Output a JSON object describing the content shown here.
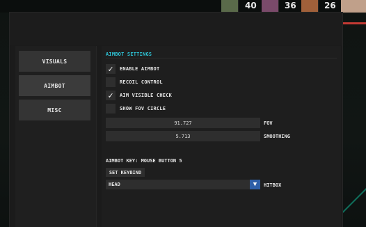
{
  "hud": {
    "counts": [
      "40",
      "36",
      "26"
    ]
  },
  "sidebar": {
    "tabs": [
      {
        "label": "VISUALS"
      },
      {
        "label": "AIMBOT"
      },
      {
        "label": "MISC"
      }
    ]
  },
  "aimbot": {
    "section_title": "AIMBOT SETTINGS",
    "checkboxes": [
      {
        "label": "ENABLE AIMBOT",
        "checked_mark": "✓"
      },
      {
        "label": "RECOIL CONTROL",
        "checked_mark": ""
      },
      {
        "label": "AIM VISIBLE CHECK",
        "checked_mark": "✓"
      },
      {
        "label": "SHOW FOV CIRCLE",
        "checked_mark": ""
      }
    ],
    "sliders": [
      {
        "value": "91.727",
        "label": "FOV"
      },
      {
        "value": "5.713",
        "label": "SMOOTHING"
      }
    ],
    "key_text": "AIMBOT KEY: MOUSE BUTTON 5",
    "set_keybind_label": "SET KEYBIND",
    "hitbox": {
      "value": "HEAD",
      "label": "HITBOX",
      "arrow": "▼"
    }
  },
  "colors": {
    "accent": "#2ec4d6",
    "dropdown_arrow_bg": "#2f5fa8",
    "hud_bar": "#c43a34"
  }
}
